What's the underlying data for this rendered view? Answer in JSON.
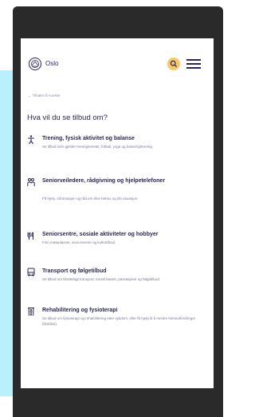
{
  "app": {
    "logo_text": "Oslo"
  },
  "breadcrumb": "← Tilbake til Aunkke",
  "page_title": "Hva vil du se tilbud om?",
  "services": [
    {
      "icon": "person-exercise-icon",
      "title": "Trening, fysisk aktivitet og balanse",
      "desc": "Se tilbud som gjelder treningssenter, fotball, yoga og basseng/trening."
    },
    {
      "icon": "people-guidance-icon",
      "title": "Seniorveiledere, rådgivning og hjelpetelefoner",
      "desc": "Få hjelp, informasjon og råd om dine behov og din situasjon."
    },
    {
      "icon": "activity-club-icon",
      "title": "Seniorsentre, sosiale aktiviteter og hobbyer",
      "desc": "Finn møteplasser, seniorsentre og kulturtilbud."
    },
    {
      "icon": "bus-icon",
      "title": "Transport og følgetilbud",
      "desc": "Se tilbud om tilrettelagt transport, trivsel basert, passasjerer og følgetilbud."
    },
    {
      "icon": "rehabilitation-icon",
      "title": "Rehabilitering og fysioterapi",
      "desc": "Se tilbud om fysioterapi og rehabilitering etter sykdom, eller få hjelp til å mestre helseutfordringer (frisklivs)."
    }
  ],
  "colors": {
    "backdrop": "#b9f0fb",
    "frame": "#2a2a2a",
    "brand_dark": "#2a2859",
    "search_accent": "#f9c66b"
  }
}
